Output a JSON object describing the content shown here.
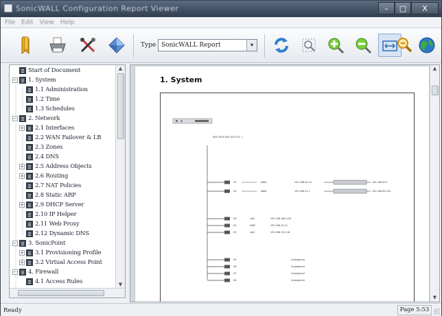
{
  "window": {
    "title": "SonicWALL Configuration Report Viewer"
  },
  "window_controls": {
    "minimize": "–",
    "maximize": "□",
    "close": "X"
  },
  "menu": [
    "File",
    "Edit",
    "View",
    "Help"
  ],
  "toolbar": {
    "left_icons": [
      "bookmark-icon",
      "print-icon",
      "tools-icon",
      "diamond-icon"
    ],
    "type_label": "Type",
    "type_value": "SonicWALL Report",
    "type_arrow": "▾",
    "right_icons": [
      "refresh-icon",
      "zoom-fit-icon",
      "zoom-in-icon",
      "zoom-out-icon",
      "fit-width-icon",
      "search-icon",
      "globe-icon"
    ]
  },
  "tree": {
    "items": [
      {
        "label": "Start of Document",
        "level": 0,
        "expander": ""
      },
      {
        "label": "1. System",
        "level": 0,
        "expander": "−"
      },
      {
        "label": "1.1 Administration",
        "level": 1,
        "expander": ""
      },
      {
        "label": "1.2 Time",
        "level": 1,
        "expander": ""
      },
      {
        "label": "1.3 Schedules",
        "level": 1,
        "expander": ""
      },
      {
        "label": "2. Network",
        "level": 0,
        "expander": "−"
      },
      {
        "label": "2.1 Interfaces",
        "level": 1,
        "expander": "+"
      },
      {
        "label": "2.2 WAN Failover & LB",
        "level": 1,
        "expander": ""
      },
      {
        "label": "2.3 Zones",
        "level": 1,
        "expander": ""
      },
      {
        "label": "2.4 DNS",
        "level": 1,
        "expander": ""
      },
      {
        "label": "2.5 Address Objects",
        "level": 1,
        "expander": "+"
      },
      {
        "label": "2.6 Routing",
        "level": 1,
        "expander": "+"
      },
      {
        "label": "2.7 NAT Policies",
        "level": 1,
        "expander": ""
      },
      {
        "label": "2.8 Static ARP",
        "level": 1,
        "expander": ""
      },
      {
        "label": "2.9 DHCP Server",
        "level": 1,
        "expander": "+"
      },
      {
        "label": "2.10 IP Helper",
        "level": 1,
        "expander": ""
      },
      {
        "label": "2.11 Web Proxy",
        "level": 1,
        "expander": ""
      },
      {
        "label": "2.12 Dynamic DNS",
        "level": 1,
        "expander": ""
      },
      {
        "label": "3. SonicPoint",
        "level": 0,
        "expander": "−"
      },
      {
        "label": "3.1 Provisioning Profile",
        "level": 1,
        "expander": "+"
      },
      {
        "label": "3.2 Virtual Access Point",
        "level": 1,
        "expander": "+"
      },
      {
        "label": "4. Firewall",
        "level": 0,
        "expander": "−"
      },
      {
        "label": "4.1 Access Rules",
        "level": 1,
        "expander": ""
      }
    ]
  },
  "document": {
    "heading": "1. System",
    "diagram": {
      "device_label": "NSA 3500 (SN: 0017C5...)",
      "ports": [
        {
          "name": "X1",
          "zone": "WAN",
          "ip": "192.168.50.10",
          "peer": "192.168.50.2"
        },
        {
          "name": "X4",
          "zone": "WAN",
          "ip": "192.168.51.1",
          "peer": "192.168.50.254"
        },
        {
          "name": "X0",
          "zone": "LAN",
          "ip": "192.168.168.1/24"
        },
        {
          "name": "X2",
          "zone": "DMZ",
          "ip": "192.168.10.12"
        },
        {
          "name": "X3",
          "zone": "LAN",
          "ip": "192.168.110.1/8"
        },
        {
          "name": "X5",
          "zone": "",
          "ip": "Unassigned"
        },
        {
          "name": "X6",
          "zone": "",
          "ip": "Unassigned"
        },
        {
          "name": "X7",
          "zone": "",
          "ip": "Unassigned"
        },
        {
          "name": "X8",
          "zone": "",
          "ip": "Unassigned"
        }
      ]
    }
  },
  "status": {
    "left": "Ready",
    "right": "Page 5:53"
  },
  "colors": {
    "titlebar": "#2f3d50",
    "accent": "#3a8ad6",
    "tree_icon": "#3c4652"
  }
}
